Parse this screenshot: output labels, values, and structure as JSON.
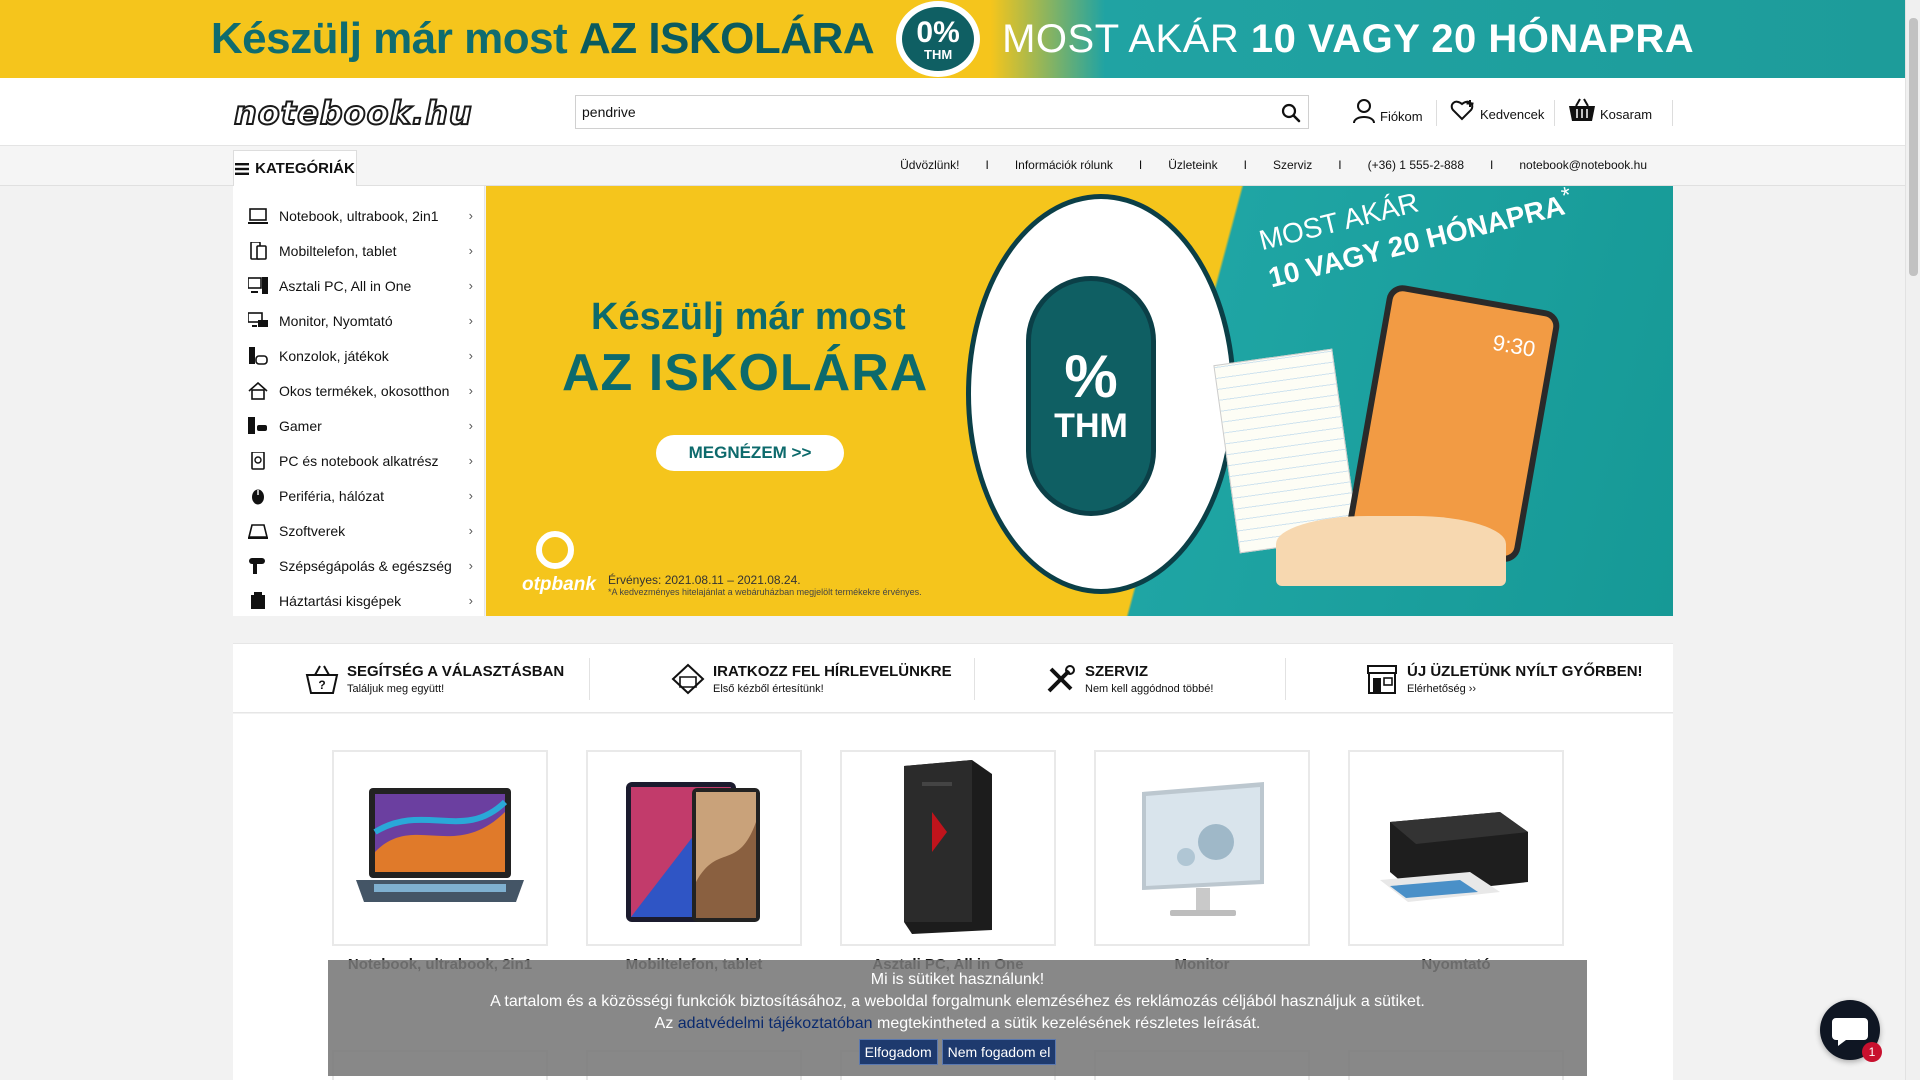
{
  "top_banner": {
    "left_prefix": "Készülj már most",
    "left_strong": "AZ ISKOLÁRA",
    "zero_pct": "0%",
    "zero_thm": "THM",
    "right_prefix": "MOST AKÁR",
    "right_strong": "10 VAGY 20 HÓNAPRA"
  },
  "header": {
    "logo_text": "notebook.hu",
    "search_value": "pendrive",
    "account_label": "Fiókom",
    "favorites_label": "Kedvencek",
    "cart_label": "Kosaram"
  },
  "nav": {
    "categories_button": "KATEGÓRIÁK",
    "links": [
      "Üdvözlünk!",
      "Információk rólunk",
      "Üzleteink",
      "Szerviz",
      "(+36) 1 555-2-888",
      "notebook@notebook.hu"
    ],
    "separator": "I"
  },
  "categories": [
    {
      "label": "Notebook, ultrabook, 2in1",
      "icon": "laptop-icon"
    },
    {
      "label": "Mobiltelefon, tablet",
      "icon": "phone-icon"
    },
    {
      "label": "Asztali PC, All in One",
      "icon": "desktop-icon"
    },
    {
      "label": "Monitor, Nyomtató",
      "icon": "monitor-printer-icon"
    },
    {
      "label": "Konzolok, játékok",
      "icon": "console-icon"
    },
    {
      "label": "Okos termékek, okosotthon",
      "icon": "smart-home-icon"
    },
    {
      "label": "Gamer",
      "icon": "gamer-icon"
    },
    {
      "label": "PC és notebook alkatrész",
      "icon": "component-icon"
    },
    {
      "label": "Periféria, hálózat",
      "icon": "mouse-icon"
    },
    {
      "label": "Szoftverek",
      "icon": "software-icon"
    },
    {
      "label": "Szépségápolás & egészség",
      "icon": "hairdryer-icon"
    },
    {
      "label": "Háztartási kisgépek",
      "icon": "appliance-icon"
    }
  ],
  "category_arrow": "›",
  "hero": {
    "line1": "Készülj már most",
    "line2": "AZ ISKOLÁRA",
    "button": "MEGNÉZEM >>",
    "promo_line1": "MOST AKÁR",
    "promo_line2": "10 VAGY 20 HÓNAPRA",
    "promo_star": "*",
    "zero_pct": "%",
    "zero_thm": "THM",
    "tablet_time": "9:30",
    "bank_name": "otpbank",
    "validity": "Érvényes: 2021.08.11 – 2021.08.24.",
    "footnote": "*A kedvezményes hitelajánlat a webáruházban megjelölt termékekre érvényes."
  },
  "info_items": [
    {
      "title": "SEGÍTSÉG A VÁLASZTÁSBAN",
      "sub": "Találjuk meg együtt!",
      "icon": "basket-help-icon"
    },
    {
      "title": "IRATKOZZ FEL HÍRLEVELÜNKRE",
      "sub": "Első kézből értesítünk!",
      "icon": "newsletter-icon"
    },
    {
      "title": "SZERVIZ",
      "sub": "Nem kell aggódnod többé!",
      "icon": "tools-icon"
    },
    {
      "title": "ÚJ ÜZLETÜNK NYÍLT GYŐRBEN!",
      "sub": "Elérhetőség ››",
      "icon": "store-icon"
    }
  ],
  "products": [
    {
      "label": "Notebook, ultrabook, 2in1",
      "icon": "laptop-image"
    },
    {
      "label": "Mobiltelefon, tablet",
      "icon": "tablet-image"
    },
    {
      "label": "Asztali PC, All in One",
      "icon": "pc-tower-image"
    },
    {
      "label": "Monitor",
      "icon": "monitor-image"
    },
    {
      "label": "Nyomtató",
      "icon": "printer-image"
    }
  ],
  "cookie": {
    "title": "Mi is sütiket használunk!",
    "line2": "A tartalom és a közösségi funkciók biztosításához, a weboldal forgalmunk elemzéséhez és reklámozás céljából használjuk a sütiket.",
    "line3_prefix": "Az",
    "line3_link": "adatvédelmi tájékoztatóban",
    "line3_suffix": "megtekintheted a sütik kezelésének részletes leírását.",
    "accept": "Elfogadom",
    "decline": "Nem fogadom el"
  },
  "chat": {
    "badge": "1"
  },
  "colors": {
    "banner_yellow": "#f5c51c",
    "banner_teal": "#1fa5a4",
    "brand_dark": "#0d6a6c",
    "cookie_button": "#1e3a6e",
    "badge_red": "#c8102e"
  }
}
